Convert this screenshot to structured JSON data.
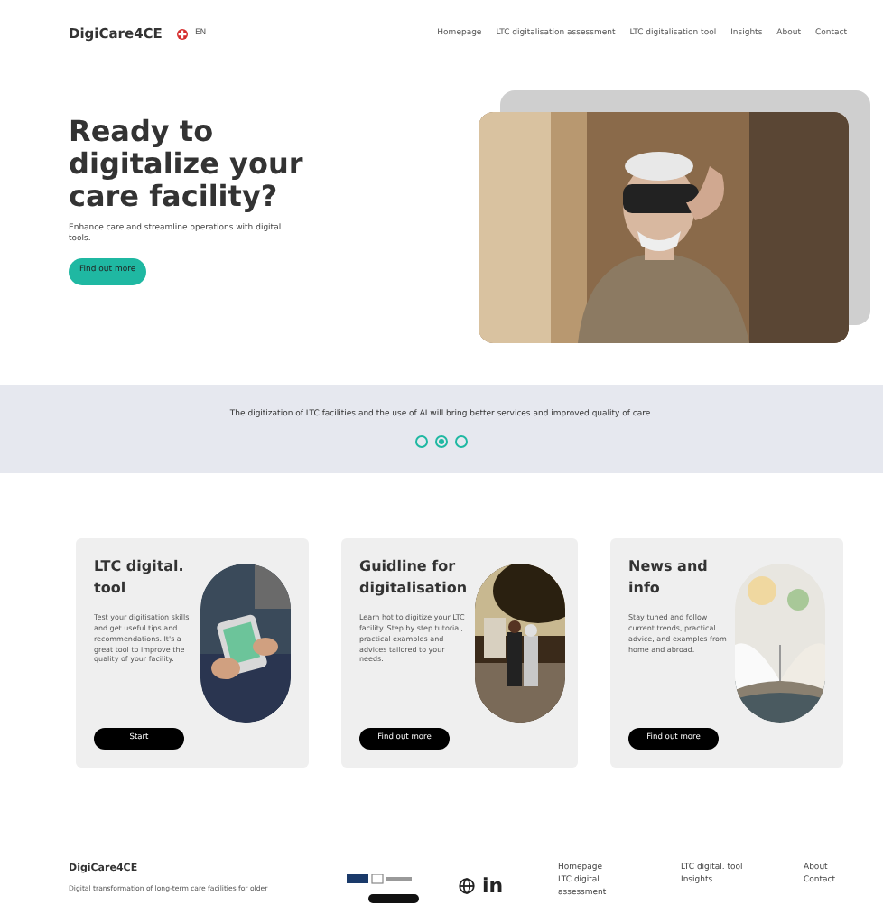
{
  "nav": {
    "brand": "DigiCare4CE",
    "language": "EN",
    "links": [
      {
        "label": "Homepage",
        "selected": false
      },
      {
        "label": "LTC digitalisation assessment",
        "selected": false
      },
      {
        "label": "LTC digitalisation tool",
        "selected": false
      },
      {
        "label": "Insights",
        "selected": false
      },
      {
        "label": "About",
        "selected": false
      },
      {
        "label": "Contact",
        "selected": false
      }
    ]
  },
  "hero": {
    "title": "Ready to digitalize your care facility?",
    "subtitle": "Enhance care and streamline operations with digital tools.",
    "button": "Find out more"
  },
  "banner": {
    "text": "The digitization of LTC facilities and the use of AI will bring better services and improved quality of care.",
    "dots": [
      {
        "selected": false
      },
      {
        "selected": true
      },
      {
        "selected": false
      }
    ]
  },
  "cards": [
    {
      "title": "LTC digital. tool",
      "text": "Test your digitisation skills and get useful tips and recommendations. It's a great tool to improve the quality of your facility.",
      "button": "Start"
    },
    {
      "title": "Guidline for digitalisation",
      "text": "Learn hot to digitize your LTC facility. Step by step tutorial, practical examples and advices tailored to your needs.",
      "button": "Find out more"
    },
    {
      "title": "News and info",
      "text": "Stay tuned and follow current trends, practical advice, and examples from home and abroad.",
      "button": "Find out more"
    }
  ],
  "footer": {
    "brand": "DigiCare4CE",
    "text": "Digital transformation of long-term care facilities for older",
    "social": "in",
    "link_columns": [
      [
        "Homepage",
        "LTC digital. assessment"
      ],
      [
        "LTC digital. tool",
        "Insights"
      ],
      [
        "About",
        "Contact"
      ]
    ]
  }
}
